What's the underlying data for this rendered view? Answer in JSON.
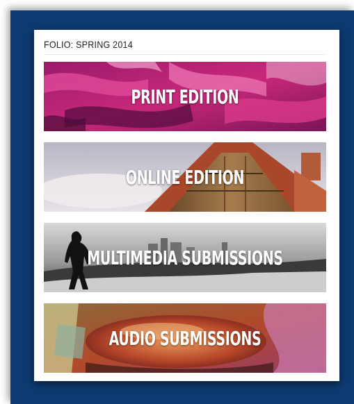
{
  "panel": {
    "title": "FOLIO: SPRING 2014"
  },
  "banners": [
    {
      "label": "PRINT EDITION",
      "image": "magenta-paint-strokes"
    },
    {
      "label": "ONLINE EDITION",
      "image": "wooden-barn-roof"
    },
    {
      "label": "MULTIMEDIA SUBMISSIONS",
      "image": "silhouette-over-city"
    },
    {
      "label": "AUDIO SUBMISSIONS",
      "image": "painted-rock-abstract"
    }
  ]
}
